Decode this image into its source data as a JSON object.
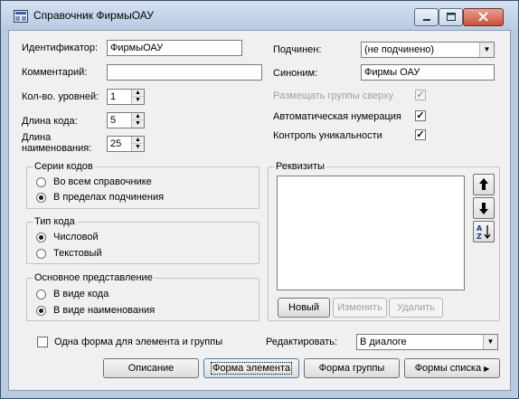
{
  "window": {
    "title": "Справочник ФирмыОАУ"
  },
  "fields": {
    "identifier_label": "Идентификатор:",
    "identifier_value": "ФирмыОАУ",
    "comment_label": "Комментарий:",
    "comment_value": "",
    "levels_label": "Кол-во. уровней:",
    "levels_value": "1",
    "code_length_label": "Длина кода:",
    "code_length_value": "5",
    "name_length_label": "Длина наименования:",
    "name_length_value": "25",
    "parent_label": "Подчинен:",
    "parent_value": "(не подчинено)",
    "synonym_label": "Синоним:",
    "synonym_value": "Фирмы ОАУ"
  },
  "options": {
    "groups_top": {
      "label": "Размещать группы сверху",
      "checked": true,
      "enabled": false
    },
    "auto_numbering": {
      "label": "Автоматическая нумерация",
      "checked": true
    },
    "uniqueness": {
      "label": "Контроль уникальности",
      "checked": true
    }
  },
  "code_series": {
    "title": "Серии кодов",
    "options": [
      "Во всем справочнике",
      "В пределах подчинения"
    ],
    "selected": 1
  },
  "code_type": {
    "title": "Тип кода",
    "options": [
      "Числовой",
      "Текстовый"
    ],
    "selected": 0
  },
  "main_view": {
    "title": "Основное представление",
    "options": [
      "В виде кода",
      "В виде наименования"
    ],
    "selected": 1
  },
  "requisites": {
    "title": "Реквизиты",
    "items": [],
    "buttons": {
      "new": "Новый",
      "edit": "Изменить",
      "delete": "Удалить"
    },
    "side_icons": [
      "arrow-up-icon",
      "arrow-down-icon",
      "sort-az-icon"
    ]
  },
  "one_form": {
    "label": "Одна форма для элемента и группы",
    "checked": false
  },
  "edit_mode": {
    "label": "Редактировать:",
    "value": "В диалоге"
  },
  "bottom_buttons": {
    "description": "Описание",
    "element_form": "Форма элемента",
    "group_form": "Форма группы",
    "list_forms": "Формы списка"
  },
  "colors": {
    "titlebar": "#c9d8ec",
    "dialog_bg": "#f0f0f0",
    "close_button": "#c9503a"
  }
}
